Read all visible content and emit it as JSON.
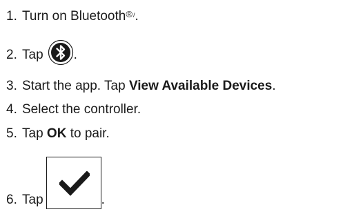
{
  "steps": [
    {
      "num": "1.",
      "text_before": "Turn on Bluetooth",
      "reg": "®",
      "slash": "/",
      "text_after": "."
    },
    {
      "num": "2.",
      "text_before": "Tap",
      "icon": "bluetooth-icon",
      "text_after": "."
    },
    {
      "num": "3.",
      "text_before": "Start the app. Tap ",
      "bold": "View Available Devices",
      "text_after": "."
    },
    {
      "num": "4.",
      "text_before": "Select the controller."
    },
    {
      "num": "5.",
      "text_before": "Tap ",
      "bold": "OK",
      "text_after": " to pair."
    },
    {
      "num": "6.",
      "text_before": "Tap",
      "icon": "checkmark-icon",
      "text_after": "."
    }
  ]
}
